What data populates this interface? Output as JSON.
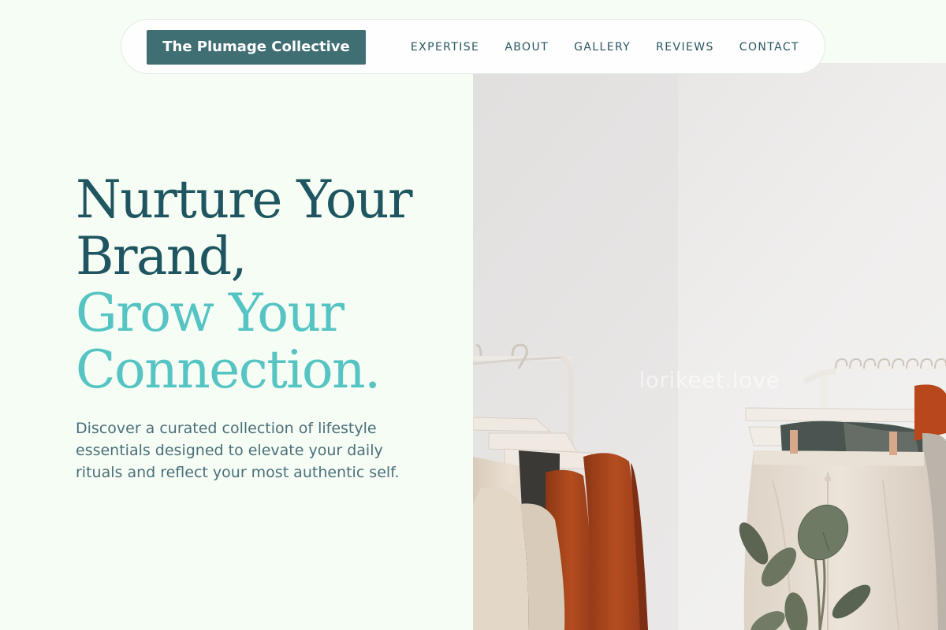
{
  "brand": {
    "name": "The Plumage Collective"
  },
  "nav": {
    "links": [
      "EXPERTISE",
      "ABOUT",
      "GALLERY",
      "REVIEWS",
      "CONTACT"
    ]
  },
  "hero": {
    "headline_line1": "Nurture Your",
    "headline_line2": "Brand,",
    "headline_line3": "Grow Your",
    "headline_line4": "Connection.",
    "description": "Discover a curated collection of lifestyle essentials designed to elevate your daily rituals and reflect your most authentic self."
  },
  "image": {
    "watermark": "lorikeet.love"
  },
  "colors": {
    "background": "#f5fdf5",
    "brand": "#3f6e73",
    "headline_dark": "#1f5560",
    "headline_accent": "#55c4c3",
    "body_text": "#4c6f7a"
  }
}
